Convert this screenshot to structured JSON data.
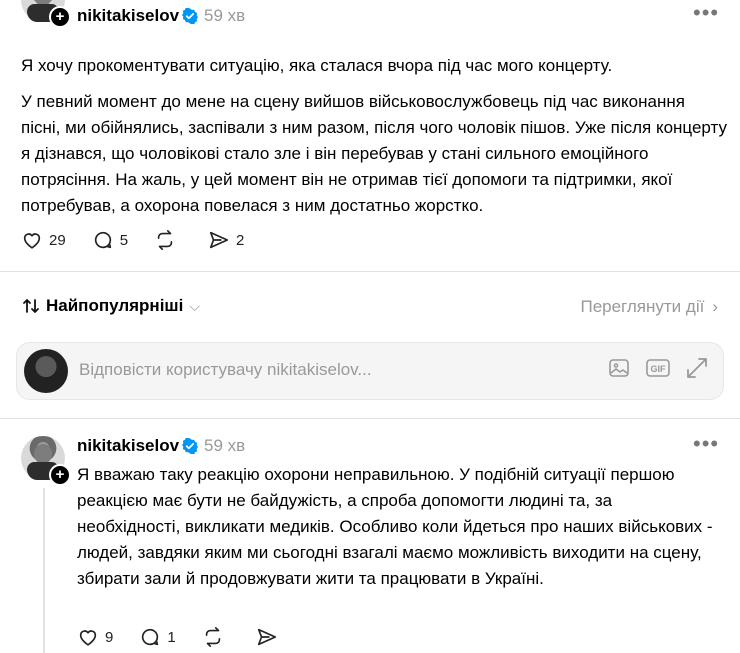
{
  "post": {
    "username": "nikitakiselov",
    "time": "59 хв",
    "paragraphs": [
      "Я хочу прокоментувати ситуацію, яка сталася вчора під час мого концерту.",
      "У певний момент до мене на сцену вийшов військовослужбовець під час виконання пісні, ми обійнялись, заспівали з ним разом, після чого чоловік пішов. Уже після концерту я дізнався, що чоловікові стало зле і він перебував у стані сильного емоційного потрясіння. На жаль, у цей момент він не отримав тієї допомоги та підтримки, якої потребував, а охорона повелася з ним достатньо жорстко."
    ],
    "likes": "29",
    "comments": "5",
    "shares": "2"
  },
  "sort": {
    "label": "Найпопулярніші",
    "view_activity": "Переглянути дії"
  },
  "reply": {
    "placeholder": "Відповісти користувачу nikitakiselov..."
  },
  "comment": {
    "username": "nikitakiselov",
    "time": "59 хв",
    "text": "Я вважаю таку реакцію охорони неправильною. У подібній ситуації першою реакцією має бути не байдужість, а спроба допомогти людині та, за необхідності, викликати медиків. Особливо коли йдеться про наших військових - людей, завдяки яким ми сьогодні взагалі маємо можливість виходити на сцену, збирати зали й продовжувати жити та працювати в Україні.",
    "likes": "9",
    "comments": "1"
  },
  "colors": {
    "verified": "#0095f6",
    "muted": "#999999",
    "divider": "#e2e2e2"
  }
}
